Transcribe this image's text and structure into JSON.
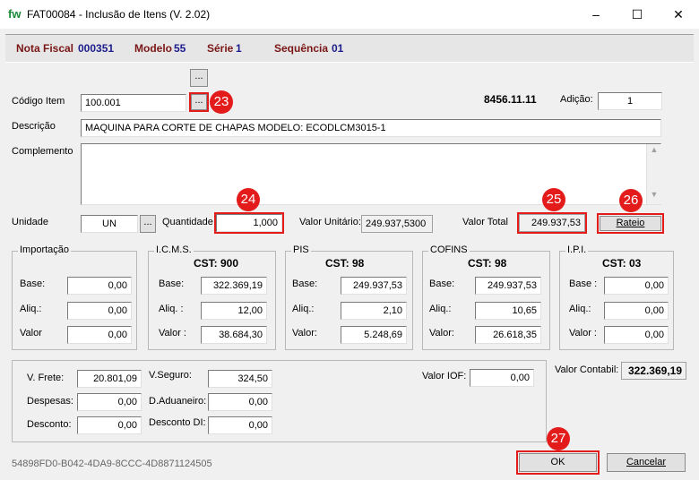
{
  "window": {
    "title": "FAT00084 - Inclusão de Itens (V. 2.02)",
    "logo_text": "fw",
    "minimize_glyph": "–",
    "maximize_glyph": "☐",
    "close_glyph": "✕"
  },
  "header": {
    "nota_fiscal_label": "Nota Fiscal",
    "nota_fiscal_value": "000351",
    "modelo_label": "Modelo",
    "modelo_value": "55",
    "serie_label": "Série",
    "serie_value": "1",
    "sequencia_label": "Sequência",
    "sequencia_value": "01"
  },
  "item": {
    "codigo_label": "Código Item",
    "codigo_value": "100.001",
    "ellipsis": "...",
    "ncm": "8456.11.11",
    "adicao_label": "Adição:",
    "adicao_value": "1",
    "descricao_label": "Descrição",
    "descricao_value": "MAQUINA PARA CORTE DE CHAPAS MODELO: ECODLCM3015-1",
    "complemento_label": "Complemento",
    "complemento_value": "",
    "unidade_label": "Unidade",
    "unidade_value": "UN",
    "quantidade_label": "Quantidade",
    "quantidade_value": "1,000",
    "valor_unitario_label": "Valor Unitário:",
    "valor_unitario_value": "249.937,5300",
    "valor_total_label": "Valor Total",
    "valor_total_value": "249.937,53",
    "rateio_label": "Rateio"
  },
  "taxes": {
    "importacao": {
      "title": "Importação",
      "base_label": "Base:",
      "aliq_label": "Aliq.:",
      "valor_label": "Valor",
      "base": "0,00",
      "aliq": "0,00",
      "valor": "0,00"
    },
    "icms": {
      "title": "I.C.M.S.",
      "cst": "CST: 900",
      "base_label": "Base:",
      "aliq_label": "Aliq. :",
      "valor_label": "Valor :",
      "base": "322.369,19",
      "aliq": "12,00",
      "valor": "38.684,30"
    },
    "pis": {
      "title": "PIS",
      "cst": "CST: 98",
      "base_label": "Base:",
      "aliq_label": "Aliq.:",
      "valor_label": "Valor:",
      "base": "249.937,53",
      "aliq": "2,10",
      "valor": "5.248,69"
    },
    "cofins": {
      "title": "COFINS",
      "cst": "CST: 98",
      "base_label": "Base:",
      "aliq_label": "Aliq.:",
      "valor_label": "Valor:",
      "base": "249.937,53",
      "aliq": "10,65",
      "valor": "26.618,35"
    },
    "ipi": {
      "title": "I.P.I.",
      "cst": "CST: 03",
      "base_label": "Base :",
      "aliq_label": "Aliq.:",
      "valor_label": "Valor :",
      "base": "0,00",
      "aliq": "0,00",
      "valor": "0,00"
    }
  },
  "extras": {
    "frete_label": "V. Frete:",
    "frete": "20.801,09",
    "seguro_label": "V.Seguro:",
    "seguro": "324,50",
    "iof_label": "Valor IOF:",
    "iof": "0,00",
    "despesas_label": "Despesas:",
    "despesas": "0,00",
    "aduaneiro_label": "D.Aduaneiro:",
    "aduaneiro": "0,00",
    "desconto_label": "Desconto:",
    "desconto": "0,00",
    "desconto_di_label": "Desconto DI:",
    "desconto_di": "0,00",
    "valor_contabil_label": "Valor Contabil:",
    "valor_contabil": "322.369,19"
  },
  "footer": {
    "guid": "54898FD0-B042-4DA9-8CCC-4D8871124505",
    "ok_label": "OK",
    "cancel_label": "Cancelar"
  },
  "callouts": {
    "c23": "23",
    "c24": "24",
    "c25": "25",
    "c26": "26",
    "c27": "27"
  },
  "colors": {
    "callout_red": "#e31b1b",
    "header_label": "#7a1616",
    "header_value": "#1c1c8c",
    "logo_green": "#1a8a3a"
  }
}
